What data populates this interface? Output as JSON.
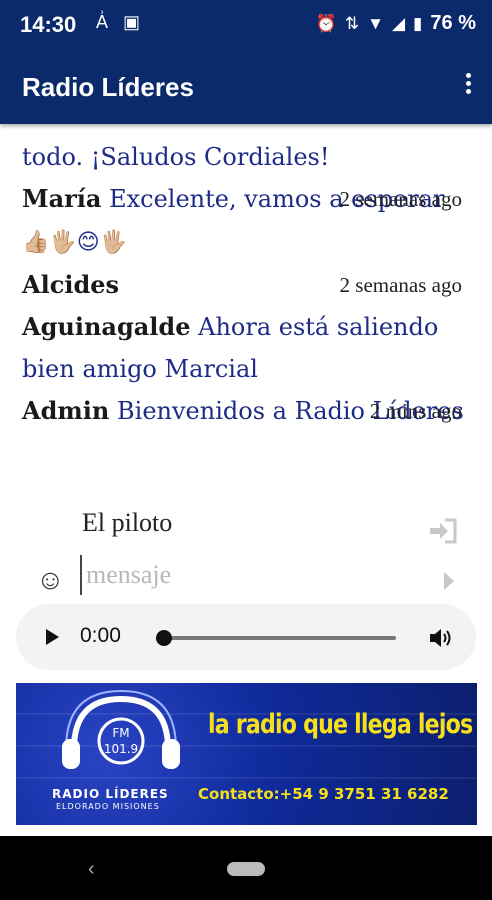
{
  "status_bar": {
    "time": "14:30",
    "battery": "76 %",
    "icons": [
      "translate-icon",
      "screenshot-icon",
      "alarm-icon",
      "data-icon",
      "wifi-icon",
      "signal-icon",
      "battery-icon"
    ]
  },
  "app_bar": {
    "title": "Radio Líderes",
    "overflow_icon": "more-vert-icon"
  },
  "chat": {
    "partial_text": "todo. ¡Saludos Cordiales!",
    "messages": [
      {
        "name": "María",
        "text": "Excelente, vamos a esperar",
        "emoji": "👍🏼🖐🏼😊🖐🏼",
        "time": "2 semanas ago"
      },
      {
        "name": "Alcides",
        "text": "",
        "time": "2 semanas ago"
      },
      {
        "name": "Aguinagalde",
        "text": "Ahora está saliendo bien amigo Marcial",
        "time": ""
      },
      {
        "name": "Admin",
        "text": "Bienvenidos a Radio Líderes",
        "time": "2 mins ago"
      }
    ]
  },
  "composer": {
    "nickname": "El piloto",
    "placeholder": "mensaje",
    "emoji_button": "☺"
  },
  "player": {
    "current_time": "0:00",
    "progress": 0
  },
  "banner": {
    "freq_label": "FM",
    "freq_value": "101.9",
    "slogan": "la radio que llega lejos",
    "contact": "Contacto:+54 9 3751 31 6282",
    "station_name": "RADIO LÍDERES",
    "location": "ELDORADO MISIONES"
  },
  "nav": {
    "back": "‹"
  },
  "colors": {
    "primary": "#0b2a6b",
    "message_text": "#1e2b87",
    "banner_yellow": "#f5e01b"
  }
}
